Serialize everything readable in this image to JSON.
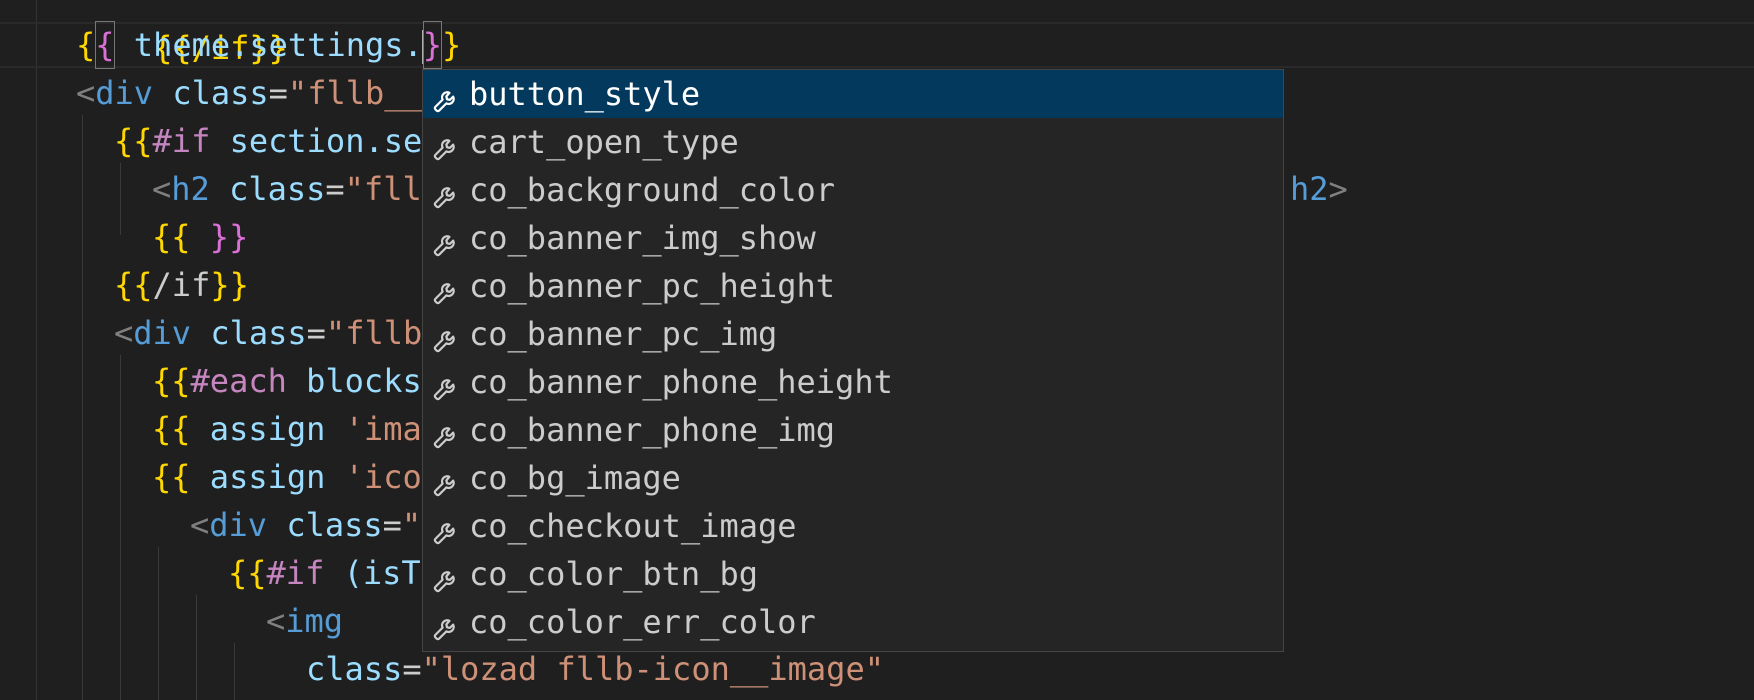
{
  "editor": {
    "lines": {
      "l0": {
        "a": "{{/if}}"
      },
      "l1": {
        "open": "{{",
        "expr": " theme.settings.",
        "close": "}}"
      },
      "l2": {
        "lt": "<",
        "tag": "div",
        "attr": " class",
        "eq": "=",
        "str": "\"fllb__"
      },
      "l3": {
        "open": "{{",
        "hash": "#if",
        "expr": " section.se"
      },
      "l4": {
        "lt": "<",
        "tag": "h2",
        "attr": " class",
        "eq": "=",
        "str": "\"fll",
        "tail_tag": "h2",
        "gt": ">"
      },
      "l5": {
        "open": "{{",
        "close": " }}"
      },
      "l6": {
        "open": "{{",
        "slash": "/if",
        "close": "}}"
      },
      "l7": {
        "lt": "<",
        "tag": "div",
        "attr": " class",
        "eq": "=",
        "str": "\"fllb"
      },
      "l8": {
        "open": "{{",
        "hash": "#each",
        "expr": " blocks"
      },
      "l9": {
        "open": "{{",
        "expr": " assign",
        "str": " 'ima"
      },
      "l10": {
        "open": "{{",
        "expr": " assign",
        "str": " 'ico"
      },
      "l11": {
        "lt": "<",
        "tag": "div",
        "attr": " class",
        "eq": "=",
        "str": "\""
      },
      "l12": {
        "open": "{{",
        "hash": "#if",
        "expr": " (isT"
      },
      "l13": {
        "lt": "<",
        "tag": "img"
      },
      "l14": {
        "attr": "class",
        "eq": "=",
        "str": "\"lozad fllb-icon__image\""
      }
    }
  },
  "suggest": {
    "icon": "wrench-icon",
    "items": [
      "button_style",
      "cart_open_type",
      "co_background_color",
      "co_banner_img_show",
      "co_banner_pc_height",
      "co_banner_pc_img",
      "co_banner_phone_height",
      "co_banner_phone_img",
      "co_bg_image",
      "co_checkout_image",
      "co_color_btn_bg",
      "co_color_err_color"
    ],
    "selected_index": 0
  },
  "colors": {
    "background": "#1f1f1f",
    "suggest_bg": "#252526",
    "selected_bg": "#04395e",
    "bracket_gold": "#ffd700",
    "bracket_pink": "#da70d6",
    "string": "#ce9178",
    "tag": "#569cd6",
    "variable": "#9cdcfe"
  }
}
